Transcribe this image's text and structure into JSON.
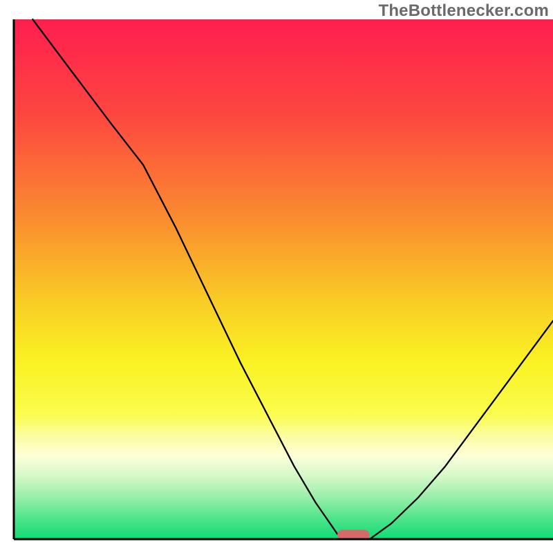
{
  "watermark": "TheBottlenecker.com",
  "chart_data": {
    "type": "line",
    "title": "",
    "xlabel": "",
    "ylabel": "",
    "xlim": [
      0,
      100
    ],
    "ylim": [
      0,
      100
    ],
    "background_gradient": {
      "type": "vertical",
      "stops": [
        {
          "pos": 0.0,
          "color": "#ff1e4f"
        },
        {
          "pos": 0.18,
          "color": "#fd4640"
        },
        {
          "pos": 0.38,
          "color": "#fa8b30"
        },
        {
          "pos": 0.55,
          "color": "#f9cf25"
        },
        {
          "pos": 0.66,
          "color": "#faf223"
        },
        {
          "pos": 0.76,
          "color": "#fbfc4e"
        },
        {
          "pos": 0.8,
          "color": "#fcfd9e"
        },
        {
          "pos": 0.84,
          "color": "#fefed9"
        },
        {
          "pos": 0.88,
          "color": "#d3f8c7"
        },
        {
          "pos": 0.92,
          "color": "#97efa9"
        },
        {
          "pos": 0.96,
          "color": "#4fe48b"
        },
        {
          "pos": 1.0,
          "color": "#10dc74"
        }
      ]
    },
    "series": [
      {
        "name": "bottleneck-curve",
        "color": "#000000",
        "stroke_width": 2.3,
        "x": [
          3.5,
          10,
          18,
          24,
          30,
          36,
          42,
          48,
          52,
          56,
          58,
          60,
          62,
          64,
          66,
          70,
          75,
          80,
          85,
          90,
          95,
          100
        ],
        "values": [
          100,
          91,
          80,
          72,
          60,
          47,
          34,
          22,
          14,
          7,
          4,
          1,
          0,
          0,
          0,
          3,
          8,
          14,
          21,
          28,
          35,
          42
        ]
      }
    ],
    "marker": {
      "name": "optimal-marker",
      "shape": "rounded-rect",
      "color": "#d46a6a",
      "x_center": 63,
      "y": 0,
      "width": 6,
      "height": 2
    },
    "axes": {
      "color": "#000000",
      "stroke_width": 3,
      "left": 2.5,
      "bottom": 2.5
    }
  }
}
